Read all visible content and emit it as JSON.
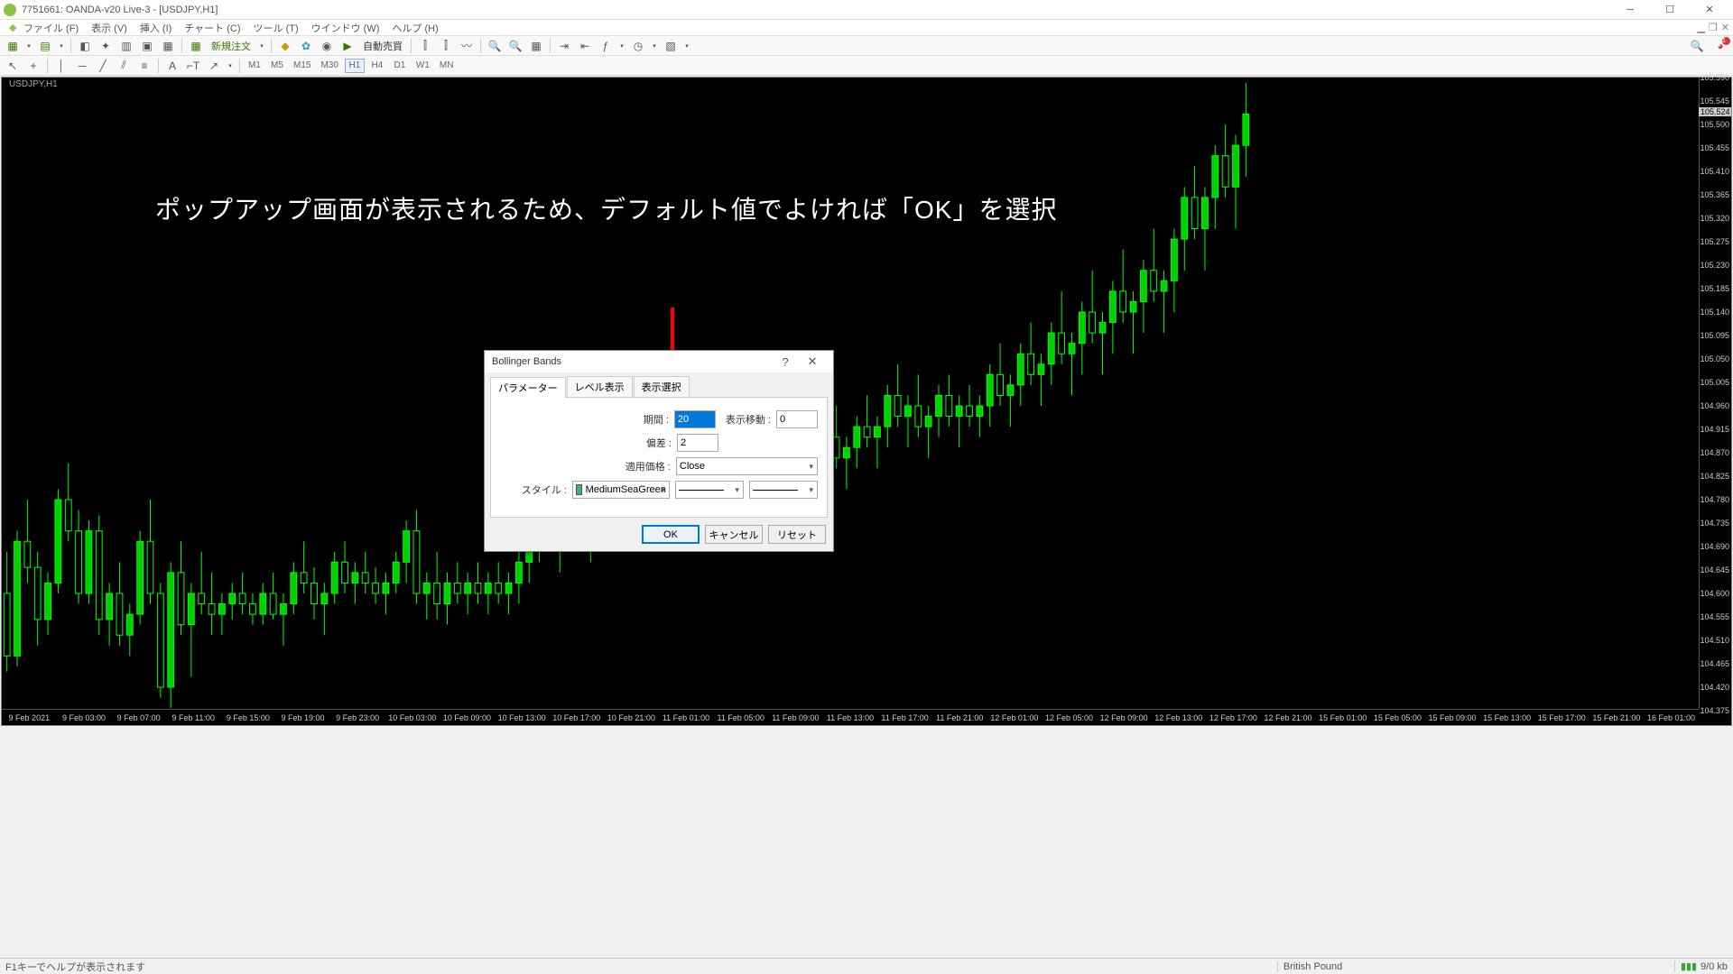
{
  "window": {
    "title": "7751661: OANDA-v20 Live-3 - [USDJPY,H1]"
  },
  "menu": {
    "items": [
      "ファイル (F)",
      "表示 (V)",
      "挿入 (I)",
      "チャート (C)",
      "ツール (T)",
      "ウインドウ (W)",
      "ヘルプ (H)"
    ]
  },
  "toolbar1": {
    "new_order": "新規注文",
    "auto_trade": "自動売買"
  },
  "timeframes": [
    "M1",
    "M5",
    "M15",
    "M30",
    "H1",
    "D1",
    "W1",
    "MN"
  ],
  "tf_extra": "H4",
  "chart": {
    "header": "USDJPY,H1"
  },
  "yaxis": [
    "105.590",
    "105.545",
    "105.500",
    "105.455",
    "105.410",
    "105.365",
    "105.320",
    "105.275",
    "105.230",
    "105.185",
    "105.140",
    "105.095",
    "105.050",
    "105.005",
    "104.960",
    "104.915",
    "104.870",
    "104.825",
    "104.780",
    "104.735",
    "104.690",
    "104.645",
    "104.600",
    "104.555",
    "104.510",
    "104.465",
    "104.420",
    "104.375"
  ],
  "yaxis_cur": "105.524",
  "xaxis": [
    "9 Feb 2021",
    "9 Feb 03:00",
    "9 Feb 07:00",
    "9 Feb 11:00",
    "9 Feb 15:00",
    "9 Feb 19:00",
    "9 Feb 23:00",
    "10 Feb 03:00",
    "10 Feb 09:00",
    "10 Feb 13:00",
    "10 Feb 17:00",
    "10 Feb 21:00",
    "11 Feb 01:00",
    "11 Feb 05:00",
    "11 Feb 09:00",
    "11 Feb 13:00",
    "11 Feb 17:00",
    "11 Feb 21:00",
    "12 Feb 01:00",
    "12 Feb 05:00",
    "12 Feb 09:00",
    "12 Feb 13:00",
    "12 Feb 17:00",
    "12 Feb 21:00",
    "15 Feb 01:00",
    "15 Feb 05:00",
    "15 Feb 09:00",
    "15 Feb 13:00",
    "15 Feb 17:00",
    "15 Feb 21:00",
    "16 Feb 01:00"
  ],
  "caption": "ポップアップ画面が表示されるため、デフォルト値でよければ「OK」を選択",
  "dialog": {
    "title": "Bollinger Bands",
    "tabs": [
      "パラメーター",
      "レベル表示",
      "表示選択"
    ],
    "labels": {
      "period": "期間 :",
      "shift": "表示移動 :",
      "dev": "偏差 :",
      "apply": "適用価格 :",
      "style": "スタイル :"
    },
    "values": {
      "period": "20",
      "shift": "0",
      "dev": "2",
      "apply": "Close",
      "color": "MediumSeaGreen"
    },
    "buttons": {
      "ok": "OK",
      "cancel": "キャンセル",
      "reset": "リセット"
    }
  },
  "status": {
    "help": "F1キーでヘルプが表示されます",
    "sym": "British Pound",
    "conn": "9/0 kb"
  },
  "chart_data": {
    "type": "candlestick",
    "symbol": "USDJPY",
    "timeframe": "H1",
    "ylim": [
      104.375,
      105.59
    ],
    "candles": [
      {
        "t": "9 Feb 00:00",
        "o": 104.6,
        "h": 104.68,
        "l": 104.45,
        "c": 104.48
      },
      {
        "t": "9 Feb 01:00",
        "o": 104.48,
        "h": 104.72,
        "l": 104.46,
        "c": 104.7
      },
      {
        "t": "9 Feb 02:00",
        "o": 104.7,
        "h": 104.78,
        "l": 104.62,
        "c": 104.65
      },
      {
        "t": "9 Feb 03:00",
        "o": 104.65,
        "h": 104.68,
        "l": 104.5,
        "c": 104.55
      },
      {
        "t": "9 Feb 04:00",
        "o": 104.55,
        "h": 104.64,
        "l": 104.52,
        "c": 104.62
      },
      {
        "t": "9 Feb 05:00",
        "o": 104.62,
        "h": 104.8,
        "l": 104.6,
        "c": 104.78
      },
      {
        "t": "9 Feb 06:00",
        "o": 104.78,
        "h": 104.85,
        "l": 104.7,
        "c": 104.72
      },
      {
        "t": "9 Feb 07:00",
        "o": 104.72,
        "h": 104.76,
        "l": 104.58,
        "c": 104.6
      },
      {
        "t": "9 Feb 08:00",
        "o": 104.6,
        "h": 104.74,
        "l": 104.58,
        "c": 104.72
      },
      {
        "t": "9 Feb 09:00",
        "o": 104.72,
        "h": 104.75,
        "l": 104.52,
        "c": 104.55
      },
      {
        "t": "9 Feb 10:00",
        "o": 104.55,
        "h": 104.62,
        "l": 104.5,
        "c": 104.6
      },
      {
        "t": "9 Feb 11:00",
        "o": 104.6,
        "h": 104.66,
        "l": 104.5,
        "c": 104.52
      },
      {
        "t": "9 Feb 12:00",
        "o": 104.52,
        "h": 104.58,
        "l": 104.48,
        "c": 104.56
      },
      {
        "t": "9 Feb 13:00",
        "o": 104.56,
        "h": 104.72,
        "l": 104.54,
        "c": 104.7
      },
      {
        "t": "9 Feb 14:00",
        "o": 104.7,
        "h": 104.78,
        "l": 104.58,
        "c": 104.6
      },
      {
        "t": "9 Feb 15:00",
        "o": 104.6,
        "h": 104.62,
        "l": 104.4,
        "c": 104.42
      },
      {
        "t": "9 Feb 16:00",
        "o": 104.42,
        "h": 104.66,
        "l": 104.38,
        "c": 104.64
      },
      {
        "t": "9 Feb 17:00",
        "o": 104.64,
        "h": 104.7,
        "l": 104.52,
        "c": 104.54
      },
      {
        "t": "9 Feb 18:00",
        "o": 104.54,
        "h": 104.62,
        "l": 104.44,
        "c": 104.6
      },
      {
        "t": "9 Feb 19:00",
        "o": 104.6,
        "h": 104.68,
        "l": 104.56,
        "c": 104.58
      },
      {
        "t": "9 Feb 20:00",
        "o": 104.58,
        "h": 104.64,
        "l": 104.52,
        "c": 104.56
      },
      {
        "t": "9 Feb 21:00",
        "o": 104.56,
        "h": 104.6,
        "l": 104.52,
        "c": 104.58
      },
      {
        "t": "9 Feb 22:00",
        "o": 104.58,
        "h": 104.62,
        "l": 104.55,
        "c": 104.6
      },
      {
        "t": "9 Feb 23:00",
        "o": 104.6,
        "h": 104.64,
        "l": 104.56,
        "c": 104.58
      },
      {
        "t": "10 Feb 00:00",
        "o": 104.58,
        "h": 104.6,
        "l": 104.54,
        "c": 104.56
      },
      {
        "t": "10 Feb 01:00",
        "o": 104.56,
        "h": 104.62,
        "l": 104.54,
        "c": 104.6
      },
      {
        "t": "10 Feb 02:00",
        "o": 104.6,
        "h": 104.64,
        "l": 104.55,
        "c": 104.56
      },
      {
        "t": "10 Feb 03:00",
        "o": 104.56,
        "h": 104.6,
        "l": 104.5,
        "c": 104.58
      },
      {
        "t": "10 Feb 04:00",
        "o": 104.58,
        "h": 104.66,
        "l": 104.56,
        "c": 104.64
      },
      {
        "t": "10 Feb 05:00",
        "o": 104.64,
        "h": 104.7,
        "l": 104.6,
        "c": 104.62
      },
      {
        "t": "10 Feb 06:00",
        "o": 104.62,
        "h": 104.65,
        "l": 104.55,
        "c": 104.58
      },
      {
        "t": "10 Feb 07:00",
        "o": 104.58,
        "h": 104.62,
        "l": 104.52,
        "c": 104.6
      },
      {
        "t": "10 Feb 08:00",
        "o": 104.6,
        "h": 104.68,
        "l": 104.58,
        "c": 104.66
      },
      {
        "t": "10 Feb 09:00",
        "o": 104.66,
        "h": 104.7,
        "l": 104.6,
        "c": 104.62
      },
      {
        "t": "10 Feb 10:00",
        "o": 104.62,
        "h": 104.66,
        "l": 104.58,
        "c": 104.64
      },
      {
        "t": "10 Feb 11:00",
        "o": 104.64,
        "h": 104.68,
        "l": 104.6,
        "c": 104.62
      },
      {
        "t": "10 Feb 12:00",
        "o": 104.62,
        "h": 104.65,
        "l": 104.58,
        "c": 104.6
      },
      {
        "t": "10 Feb 13:00",
        "o": 104.6,
        "h": 104.64,
        "l": 104.56,
        "c": 104.62
      },
      {
        "t": "10 Feb 14:00",
        "o": 104.62,
        "h": 104.68,
        "l": 104.6,
        "c": 104.66
      },
      {
        "t": "10 Feb 15:00",
        "o": 104.66,
        "h": 104.74,
        "l": 104.62,
        "c": 104.72
      },
      {
        "t": "10 Feb 16:00",
        "o": 104.72,
        "h": 104.76,
        "l": 104.58,
        "c": 104.6
      },
      {
        "t": "10 Feb 17:00",
        "o": 104.6,
        "h": 104.64,
        "l": 104.55,
        "c": 104.62
      },
      {
        "t": "10 Feb 18:00",
        "o": 104.62,
        "h": 104.68,
        "l": 104.55,
        "c": 104.58
      },
      {
        "t": "10 Feb 19:00",
        "o": 104.58,
        "h": 104.64,
        "l": 104.54,
        "c": 104.62
      },
      {
        "t": "10 Feb 20:00",
        "o": 104.62,
        "h": 104.66,
        "l": 104.58,
        "c": 104.6
      },
      {
        "t": "10 Feb 21:00",
        "o": 104.6,
        "h": 104.64,
        "l": 104.56,
        "c": 104.62
      },
      {
        "t": "10 Feb 22:00",
        "o": 104.62,
        "h": 104.66,
        "l": 104.58,
        "c": 104.6
      },
      {
        "t": "10 Feb 23:00",
        "o": 104.6,
        "h": 104.64,
        "l": 104.56,
        "c": 104.62
      },
      {
        "t": "11 Feb 00:00",
        "o": 104.62,
        "h": 104.66,
        "l": 104.58,
        "c": 104.6
      },
      {
        "t": "11 Feb 01:00",
        "o": 104.6,
        "h": 104.64,
        "l": 104.56,
        "c": 104.62
      },
      {
        "t": "11 Feb 02:00",
        "o": 104.62,
        "h": 104.68,
        "l": 104.58,
        "c": 104.66
      },
      {
        "t": "11 Feb 03:00",
        "o": 104.66,
        "h": 104.72,
        "l": 104.62,
        "c": 104.7
      },
      {
        "t": "11 Feb 04:00",
        "o": 104.7,
        "h": 104.76,
        "l": 104.66,
        "c": 104.74
      },
      {
        "t": "11 Feb 05:00",
        "o": 104.74,
        "h": 104.78,
        "l": 104.68,
        "c": 104.7
      },
      {
        "t": "11 Feb 06:00",
        "o": 104.7,
        "h": 104.74,
        "l": 104.64,
        "c": 104.72
      },
      {
        "t": "11 Feb 07:00",
        "o": 104.72,
        "h": 104.78,
        "l": 104.68,
        "c": 104.76
      },
      {
        "t": "11 Feb 08:00",
        "o": 104.76,
        "h": 104.8,
        "l": 104.7,
        "c": 104.72
      },
      {
        "t": "11 Feb 09:00",
        "o": 104.72,
        "h": 104.76,
        "l": 104.66,
        "c": 104.74
      },
      {
        "t": "11 Feb 10:00",
        "o": 104.74,
        "h": 104.8,
        "l": 104.7,
        "c": 104.78
      },
      {
        "t": "11 Feb 11:00",
        "o": 104.78,
        "h": 104.84,
        "l": 104.74,
        "c": 104.82
      },
      {
        "t": "11 Feb 12:00",
        "o": 104.82,
        "h": 104.88,
        "l": 104.78,
        "c": 104.8
      },
      {
        "t": "11 Feb 13:00",
        "o": 104.8,
        "h": 104.84,
        "l": 104.72,
        "c": 104.74
      },
      {
        "t": "11 Feb 14:00",
        "o": 104.74,
        "h": 104.78,
        "l": 104.68,
        "c": 104.76
      },
      {
        "t": "11 Feb 15:00",
        "o": 104.76,
        "h": 104.84,
        "l": 104.72,
        "c": 104.82
      },
      {
        "t": "11 Feb 16:00",
        "o": 104.82,
        "h": 104.86,
        "l": 104.74,
        "c": 104.76
      },
      {
        "t": "11 Feb 17:00",
        "o": 104.76,
        "h": 104.8,
        "l": 104.7,
        "c": 104.78
      },
      {
        "t": "11 Feb 18:00",
        "o": 104.78,
        "h": 104.82,
        "l": 104.72,
        "c": 104.74
      },
      {
        "t": "11 Feb 19:00",
        "o": 104.74,
        "h": 104.78,
        "l": 104.68,
        "c": 104.76
      },
      {
        "t": "11 Feb 20:00",
        "o": 104.76,
        "h": 104.8,
        "l": 104.72,
        "c": 104.78
      },
      {
        "t": "11 Feb 21:00",
        "o": 104.78,
        "h": 104.82,
        "l": 104.74,
        "c": 104.8
      },
      {
        "t": "11 Feb 22:00",
        "o": 104.8,
        "h": 104.84,
        "l": 104.76,
        "c": 104.78
      },
      {
        "t": "11 Feb 23:00",
        "o": 104.78,
        "h": 104.82,
        "l": 104.72,
        "c": 104.8
      },
      {
        "t": "12 Feb 00:00",
        "o": 104.8,
        "h": 104.86,
        "l": 104.76,
        "c": 104.84
      },
      {
        "t": "12 Feb 01:00",
        "o": 104.84,
        "h": 104.88,
        "l": 104.78,
        "c": 104.8
      },
      {
        "t": "12 Feb 02:00",
        "o": 104.8,
        "h": 104.84,
        "l": 104.74,
        "c": 104.82
      },
      {
        "t": "12 Feb 03:00",
        "o": 104.82,
        "h": 104.9,
        "l": 104.78,
        "c": 104.88
      },
      {
        "t": "12 Feb 04:00",
        "o": 104.88,
        "h": 104.94,
        "l": 104.82,
        "c": 104.84
      },
      {
        "t": "12 Feb 05:00",
        "o": 104.84,
        "h": 104.88,
        "l": 104.78,
        "c": 104.86
      },
      {
        "t": "12 Feb 06:00",
        "o": 104.86,
        "h": 104.92,
        "l": 104.82,
        "c": 104.9
      },
      {
        "t": "12 Feb 07:00",
        "o": 104.9,
        "h": 104.96,
        "l": 104.86,
        "c": 104.88
      },
      {
        "t": "12 Feb 08:00",
        "o": 104.88,
        "h": 104.92,
        "l": 104.82,
        "c": 104.9
      },
      {
        "t": "12 Feb 09:00",
        "o": 104.9,
        "h": 104.96,
        "l": 104.84,
        "c": 104.86
      },
      {
        "t": "12 Feb 10:00",
        "o": 104.86,
        "h": 104.9,
        "l": 104.8,
        "c": 104.88
      },
      {
        "t": "12 Feb 11:00",
        "o": 104.88,
        "h": 104.94,
        "l": 104.84,
        "c": 104.92
      },
      {
        "t": "12 Feb 12:00",
        "o": 104.92,
        "h": 104.98,
        "l": 104.88,
        "c": 104.9
      },
      {
        "t": "12 Feb 13:00",
        "o": 104.9,
        "h": 104.94,
        "l": 104.84,
        "c": 104.92
      },
      {
        "t": "12 Feb 14:00",
        "o": 104.92,
        "h": 105.0,
        "l": 104.88,
        "c": 104.98
      },
      {
        "t": "12 Feb 15:00",
        "o": 104.98,
        "h": 105.04,
        "l": 104.92,
        "c": 104.94
      },
      {
        "t": "12 Feb 16:00",
        "o": 104.94,
        "h": 104.98,
        "l": 104.88,
        "c": 104.96
      },
      {
        "t": "12 Feb 17:00",
        "o": 104.96,
        "h": 105.02,
        "l": 104.9,
        "c": 104.92
      },
      {
        "t": "12 Feb 18:00",
        "o": 104.92,
        "h": 104.96,
        "l": 104.86,
        "c": 104.94
      },
      {
        "t": "12 Feb 19:00",
        "o": 104.94,
        "h": 105.0,
        "l": 104.9,
        "c": 104.98
      },
      {
        "t": "12 Feb 20:00",
        "o": 104.98,
        "h": 105.02,
        "l": 104.92,
        "c": 104.94
      },
      {
        "t": "12 Feb 21:00",
        "o": 104.94,
        "h": 104.98,
        "l": 104.88,
        "c": 104.96
      },
      {
        "t": "12 Feb 22:00",
        "o": 104.96,
        "h": 105.0,
        "l": 104.92,
        "c": 104.94
      },
      {
        "t": "12 Feb 23:00",
        "o": 104.94,
        "h": 104.98,
        "l": 104.9,
        "c": 104.96
      },
      {
        "t": "15 Feb 00:00",
        "o": 104.96,
        "h": 105.04,
        "l": 104.92,
        "c": 105.02
      },
      {
        "t": "15 Feb 01:00",
        "o": 105.02,
        "h": 105.08,
        "l": 104.96,
        "c": 104.98
      },
      {
        "t": "15 Feb 02:00",
        "o": 104.98,
        "h": 105.02,
        "l": 104.92,
        "c": 105.0
      },
      {
        "t": "15 Feb 03:00",
        "o": 105.0,
        "h": 105.08,
        "l": 104.96,
        "c": 105.06
      },
      {
        "t": "15 Feb 04:00",
        "o": 105.06,
        "h": 105.12,
        "l": 105.0,
        "c": 105.02
      },
      {
        "t": "15 Feb 05:00",
        "o": 105.02,
        "h": 105.06,
        "l": 104.96,
        "c": 105.04
      },
      {
        "t": "15 Feb 06:00",
        "o": 105.04,
        "h": 105.12,
        "l": 105.0,
        "c": 105.1
      },
      {
        "t": "15 Feb 07:00",
        "o": 105.1,
        "h": 105.18,
        "l": 105.04,
        "c": 105.06
      },
      {
        "t": "15 Feb 08:00",
        "o": 105.06,
        "h": 105.1,
        "l": 104.98,
        "c": 105.08
      },
      {
        "t": "15 Feb 09:00",
        "o": 105.08,
        "h": 105.16,
        "l": 105.02,
        "c": 105.14
      },
      {
        "t": "15 Feb 10:00",
        "o": 105.14,
        "h": 105.22,
        "l": 105.08,
        "c": 105.1
      },
      {
        "t": "15 Feb 11:00",
        "o": 105.1,
        "h": 105.14,
        "l": 105.02,
        "c": 105.12
      },
      {
        "t": "15 Feb 12:00",
        "o": 105.12,
        "h": 105.2,
        "l": 105.06,
        "c": 105.18
      },
      {
        "t": "15 Feb 13:00",
        "o": 105.18,
        "h": 105.26,
        "l": 105.12,
        "c": 105.14
      },
      {
        "t": "15 Feb 14:00",
        "o": 105.14,
        "h": 105.18,
        "l": 105.06,
        "c": 105.16
      },
      {
        "t": "15 Feb 15:00",
        "o": 105.16,
        "h": 105.24,
        "l": 105.1,
        "c": 105.22
      },
      {
        "t": "15 Feb 16:00",
        "o": 105.22,
        "h": 105.3,
        "l": 105.16,
        "c": 105.18
      },
      {
        "t": "15 Feb 17:00",
        "o": 105.18,
        "h": 105.22,
        "l": 105.1,
        "c": 105.2
      },
      {
        "t": "15 Feb 18:00",
        "o": 105.2,
        "h": 105.3,
        "l": 105.14,
        "c": 105.28
      },
      {
        "t": "15 Feb 19:00",
        "o": 105.28,
        "h": 105.38,
        "l": 105.22,
        "c": 105.36
      },
      {
        "t": "15 Feb 20:00",
        "o": 105.36,
        "h": 105.42,
        "l": 105.28,
        "c": 105.3
      },
      {
        "t": "15 Feb 21:00",
        "o": 105.3,
        "h": 105.38,
        "l": 105.22,
        "c": 105.36
      },
      {
        "t": "15 Feb 22:00",
        "o": 105.36,
        "h": 105.46,
        "l": 105.3,
        "c": 105.44
      },
      {
        "t": "15 Feb 23:00",
        "o": 105.44,
        "h": 105.5,
        "l": 105.36,
        "c": 105.38
      },
      {
        "t": "16 Feb 00:00",
        "o": 105.38,
        "h": 105.48,
        "l": 105.3,
        "c": 105.46
      },
      {
        "t": "16 Feb 01:00",
        "o": 105.46,
        "h": 105.58,
        "l": 105.4,
        "c": 105.52
      }
    ]
  }
}
